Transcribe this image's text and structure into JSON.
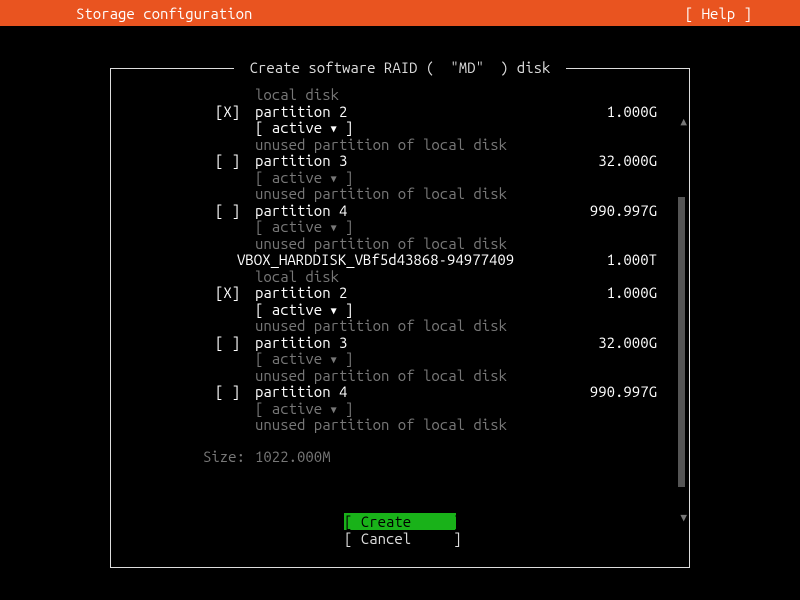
{
  "header": {
    "title": "Storage configuration",
    "help": "[ Help ]"
  },
  "dialog": {
    "title_prefix": " Create software RAID (",
    "title_quote": "\"MD\"",
    "title_suffix": ") disk "
  },
  "rows": [
    {
      "check": "",
      "name": "local disk",
      "size": "",
      "dim": true
    },
    {
      "check": "[X]",
      "name": "partition 2",
      "size": "1.000G",
      "dim": false
    },
    {
      "check": "",
      "name": "[ active ▾ ]",
      "size": "",
      "dim": false
    },
    {
      "check": "",
      "name": "unused partition of local disk",
      "size": "",
      "dim": true
    },
    {
      "check": "[ ]",
      "name": "partition 3",
      "size": "32.000G",
      "dim": false
    },
    {
      "check": "",
      "name": "[ active ▾ ]",
      "size": "",
      "dim": true
    },
    {
      "check": "",
      "name": "unused partition of local disk",
      "size": "",
      "dim": true
    },
    {
      "check": "[ ]",
      "name": "partition 4",
      "size": "990.997G",
      "dim": false
    },
    {
      "check": "",
      "name": "[ active ▾ ]",
      "size": "",
      "dim": true
    },
    {
      "check": "",
      "name": "unused partition of local disk",
      "size": "",
      "dim": true
    },
    {
      "check": "",
      "name": "VBOX_HARDDISK_VBf5d43868-94977409",
      "size": "1.000T",
      "dim": false,
      "shift": true
    },
    {
      "check": "",
      "name": "local disk",
      "size": "",
      "dim": true
    },
    {
      "check": "[X]",
      "name": "partition 2",
      "size": "1.000G",
      "dim": false
    },
    {
      "check": "",
      "name": "[ active ▾ ]",
      "size": "",
      "dim": false
    },
    {
      "check": "",
      "name": "unused partition of local disk",
      "size": "",
      "dim": true
    },
    {
      "check": "[ ]",
      "name": "partition 3",
      "size": "32.000G",
      "dim": false
    },
    {
      "check": "",
      "name": "[ active ▾ ]",
      "size": "",
      "dim": true
    },
    {
      "check": "",
      "name": "unused partition of local disk",
      "size": "",
      "dim": true
    },
    {
      "check": "[ ]",
      "name": "partition 4",
      "size": "990.997G",
      "dim": false
    },
    {
      "check": "",
      "name": "[ active ▾ ]",
      "size": "",
      "dim": true
    },
    {
      "check": "",
      "name": "unused partition of local disk",
      "size": "",
      "dim": true
    }
  ],
  "size": {
    "label": "Size:",
    "value": "1022.000M"
  },
  "buttons": {
    "create": "[ Create     ]",
    "cancel": "[ Cancel     ]"
  }
}
